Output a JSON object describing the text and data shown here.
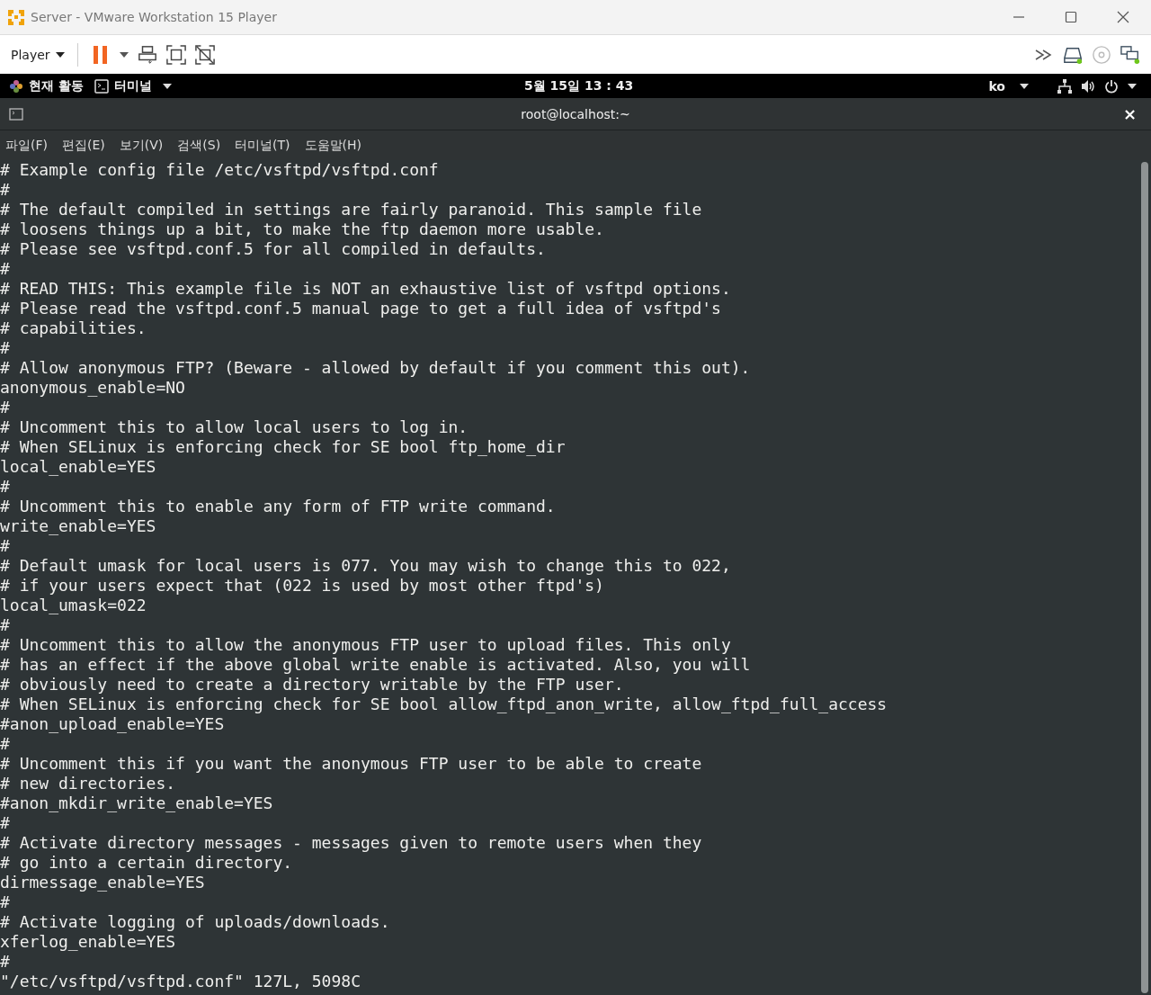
{
  "window": {
    "title": "Server - VMware Workstation 15 Player"
  },
  "toolbar": {
    "player_menu": "Player"
  },
  "top_bar": {
    "activities": "현재 활동",
    "app_menu": "터미널",
    "clock": "5월 15일  13 : 43",
    "input_method": "ko"
  },
  "terminal": {
    "title": "root@localhost:~",
    "close": "×",
    "menu": [
      "파일(F)",
      "편집(E)",
      "보기(V)",
      "검색(S)",
      "터미널(T)",
      "도움말(H)"
    ],
    "lines": [
      "# Example config file /etc/vsftpd/vsftpd.conf",
      "#",
      "# The default compiled in settings are fairly paranoid. This sample file",
      "# loosens things up a bit, to make the ftp daemon more usable.",
      "# Please see vsftpd.conf.5 for all compiled in defaults.",
      "#",
      "# READ THIS: This example file is NOT an exhaustive list of vsftpd options.",
      "# Please read the vsftpd.conf.5 manual page to get a full idea of vsftpd's",
      "# capabilities.",
      "#",
      "# Allow anonymous FTP? (Beware - allowed by default if you comment this out).",
      "anonymous_enable=NO",
      "#",
      "# Uncomment this to allow local users to log in.",
      "# When SELinux is enforcing check for SE bool ftp_home_dir",
      "local_enable=YES",
      "#",
      "# Uncomment this to enable any form of FTP write command.",
      "write_enable=YES",
      "#",
      "# Default umask for local users is 077. You may wish to change this to 022,",
      "# if your users expect that (022 is used by most other ftpd's)",
      "local_umask=022",
      "#",
      "# Uncomment this to allow the anonymous FTP user to upload files. This only",
      "# has an effect if the above global write enable is activated. Also, you will",
      "# obviously need to create a directory writable by the FTP user.",
      "# When SELinux is enforcing check for SE bool allow_ftpd_anon_write, allow_ftpd_full_access",
      "#anon_upload_enable=YES",
      "#",
      "# Uncomment this if you want the anonymous FTP user to be able to create",
      "# new directories.",
      "#anon_mkdir_write_enable=YES",
      "#",
      "# Activate directory messages - messages given to remote users when they",
      "# go into a certain directory.",
      "dirmessage_enable=YES",
      "#",
      "# Activate logging of uploads/downloads.",
      "xferlog_enable=YES",
      "#"
    ],
    "status_line": "\"/etc/vsftpd/vsftpd.conf\" 127L, 5098C"
  }
}
